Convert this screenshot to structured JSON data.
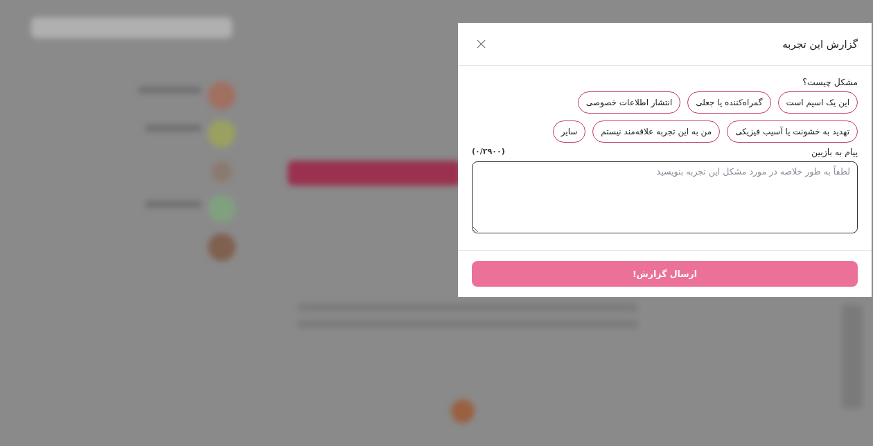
{
  "dialog": {
    "title": "گزارش این تجربه",
    "question": "مشکل چیست؟",
    "reasons": [
      {
        "label": "این یک اسپم است",
        "selected": false
      },
      {
        "label": "گمراه‌کننده یا جعلی",
        "selected": false
      },
      {
        "label": "انتشار اطلاعات خصوصی",
        "selected": false
      },
      {
        "label": "تهدید به خشونت یا آسیب فیزیکی",
        "selected": false
      },
      {
        "label": "من به این تجربه علاقه‌مند نیستم",
        "selected": false
      },
      {
        "label": "سایر",
        "selected": false
      }
    ],
    "message_label": "پیام به بازبین",
    "counter": "(۰/۲۹۰۰)",
    "message": {
      "placeholder": "لطفاً به طور خلاصه در مورد مشکل این تجربه بنویسید"
    },
    "submit": {
      "label": "ارسال گزارش!",
      "disabled": true
    }
  }
}
